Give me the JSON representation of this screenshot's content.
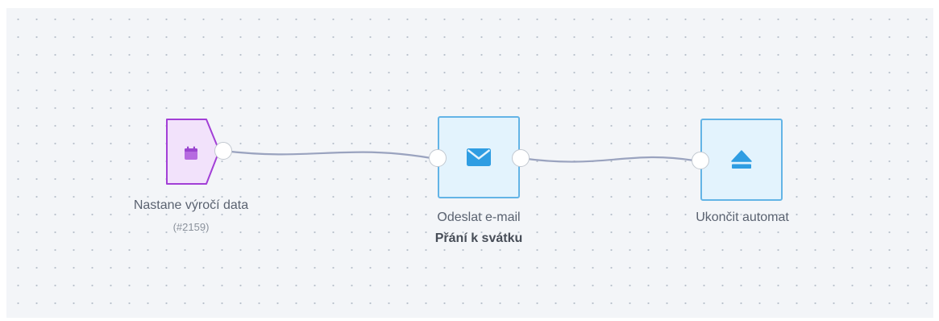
{
  "canvas": {
    "background": "#f3f5f8",
    "dot_color": "#b9c1cc"
  },
  "nodes": {
    "trigger": {
      "label": "Nastane výročí data",
      "id_text": "(#2159)",
      "icon": "calendar-icon",
      "fill": "#f2e2fb",
      "stroke": "#a23fd6"
    },
    "send_email": {
      "label": "Odeslat e-mail",
      "subtitle": "Přání k svátku",
      "icon": "envelope-icon",
      "fill": "#e3f3fd",
      "stroke": "#63b4e6"
    },
    "end": {
      "label": "Ukončit automat",
      "icon": "eject-icon",
      "fill": "#e3f3fd",
      "stroke": "#63b4e6"
    }
  },
  "connector_color": "#9aa3bf"
}
